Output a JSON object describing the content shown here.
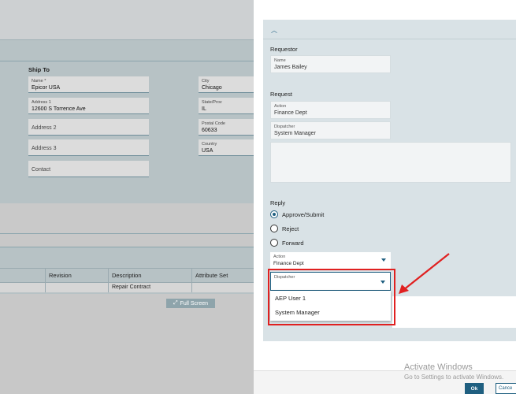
{
  "background": {
    "ship_to": {
      "heading": "Ship To",
      "name": {
        "label": "Name *",
        "value": "Epicor USA"
      },
      "address1": {
        "label": "Address 1",
        "value": "12600 S Torrence Ave"
      },
      "address2": {
        "placeholder": "Address 2"
      },
      "address3": {
        "placeholder": "Address 3"
      },
      "contact": {
        "placeholder": "Contact"
      },
      "city": {
        "label": "City",
        "value": "Chicago"
      },
      "state": {
        "label": "State/Prov",
        "value": "IL"
      },
      "postal": {
        "label": "Postal Code",
        "value": "60633"
      },
      "country": {
        "label": "Country",
        "value": "USA"
      }
    },
    "grid": {
      "columns": [
        "Revision",
        "Description",
        "Attribute Set"
      ],
      "row": [
        "",
        "Repair Contract",
        ""
      ]
    },
    "full_screen_label": "Full Screen"
  },
  "panel": {
    "requestor": {
      "heading": "Requestor",
      "name": {
        "label": "Name",
        "value": "James Bailey"
      }
    },
    "request": {
      "heading": "Request",
      "action": {
        "label": "Action",
        "value": "Finance Dept"
      },
      "dispatcher": {
        "label": "Dispatcher",
        "value": "System Manager"
      }
    },
    "reply": {
      "heading": "Reply",
      "options": [
        "Approve/Submit",
        "Reject",
        "Forward"
      ],
      "selected_option": "Approve/Submit",
      "action": {
        "label": "Action",
        "value": "Finance Dept"
      },
      "dispatcher": {
        "label": "Dispatcher",
        "value": ""
      },
      "dispatcher_options": [
        "AEP User 1",
        "System Manager"
      ]
    },
    "footer": {
      "ok_label": "Ok",
      "cancel_label": "Cance"
    }
  },
  "watermark": {
    "line1": "Activate Windows",
    "line2": "Go to Settings to activate Windows."
  },
  "colors": {
    "accent": "#1f5f80",
    "highlight": "#e02020"
  }
}
